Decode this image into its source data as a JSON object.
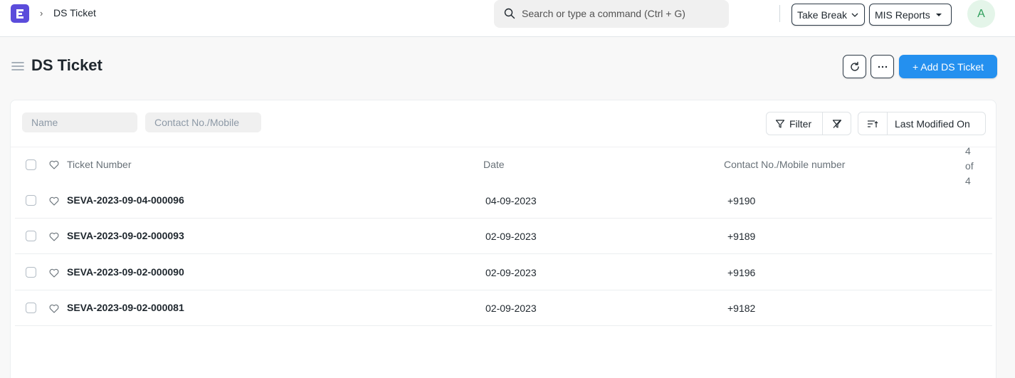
{
  "navbar": {
    "logo_letter": "E",
    "breadcrumb_sep": "›",
    "breadcrumb": "DS Ticket",
    "search_placeholder": "Search or type a command (Ctrl + G)",
    "take_break_label": "Take Break",
    "mis_reports_label": "MIS Reports",
    "avatar_initial": "A"
  },
  "page": {
    "title": "DS Ticket",
    "add_button_label": "+ Add DS Ticket"
  },
  "filters": {
    "name_placeholder": "Name",
    "contact_placeholder": "Contact No./Mobile",
    "filter_label": "Filter",
    "sort_label": "Last Modified On"
  },
  "table": {
    "columns": [
      "Ticket Number",
      "Date",
      "Contact No./Mobile number"
    ],
    "count": [
      "4",
      "of",
      "4"
    ],
    "rows": [
      {
        "ticket": "SEVA-2023-09-04-000096",
        "date": "04-09-2023",
        "contact": "+9190"
      },
      {
        "ticket": "SEVA-2023-09-02-000093",
        "date": "02-09-2023",
        "contact": "+9189"
      },
      {
        "ticket": "SEVA-2023-09-02-000090",
        "date": "02-09-2023",
        "contact": "+9196"
      },
      {
        "ticket": "SEVA-2023-09-02-000081",
        "date": "02-09-2023",
        "contact": "+9182"
      }
    ]
  },
  "colors": {
    "brand": "#5b4cdb",
    "primary": "#2490ef",
    "avatar_bg": "#e4f5e9"
  },
  "icons": [
    "search-icon",
    "chevron-down-icon",
    "caret-down-icon",
    "menu-icon",
    "refresh-icon",
    "more-icon",
    "filter-icon",
    "filter-clear-icon",
    "sort-icon",
    "heart-icon",
    "checkbox"
  ]
}
